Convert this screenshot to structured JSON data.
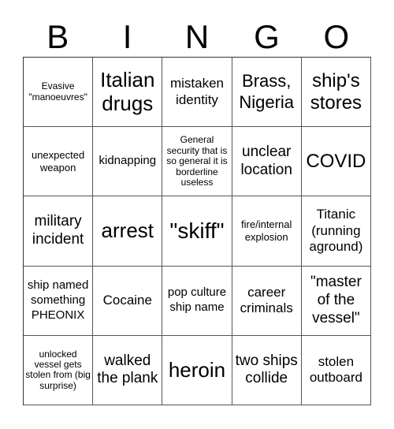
{
  "header": [
    "B",
    "I",
    "N",
    "G",
    "O"
  ],
  "cells": [
    {
      "text": "Evasive \"manoeuvres\"",
      "size": "f12"
    },
    {
      "text": "Italian drugs",
      "size": "f26"
    },
    {
      "text": "mistaken identity",
      "size": "f17"
    },
    {
      "text": "Brass, Nigeria",
      "size": "f22"
    },
    {
      "text": "ship's stores",
      "size": "f24"
    },
    {
      "text": "unexpected weapon",
      "size": "f13"
    },
    {
      "text": "kidnapping",
      "size": "f15"
    },
    {
      "text": "General security that is so general it is borderline useless",
      "size": "f12"
    },
    {
      "text": "unclear location",
      "size": "f19"
    },
    {
      "text": "COVID",
      "size": "f24"
    },
    {
      "text": "military incident",
      "size": "f19"
    },
    {
      "text": "arrest",
      "size": "f26"
    },
    {
      "text": "\"skiff\"",
      "size": "f28"
    },
    {
      "text": "fire/internal explosion",
      "size": "f13"
    },
    {
      "text": "Titanic (running aground)",
      "size": "f17"
    },
    {
      "text": "ship named something PHEONIX",
      "size": "f15"
    },
    {
      "text": "Cocaine",
      "size": "f17"
    },
    {
      "text": "pop culture ship name",
      "size": "f15"
    },
    {
      "text": "career criminals",
      "size": "f17"
    },
    {
      "text": "\"master of the vessel\"",
      "size": "f19"
    },
    {
      "text": "unlocked vessel gets stolen from (big surprise)",
      "size": "f12"
    },
    {
      "text": "walked the plank",
      "size": "f19"
    },
    {
      "text": "heroin",
      "size": "f26"
    },
    {
      "text": "two ships collide",
      "size": "f19"
    },
    {
      "text": "stolen outboard",
      "size": "f17"
    }
  ]
}
